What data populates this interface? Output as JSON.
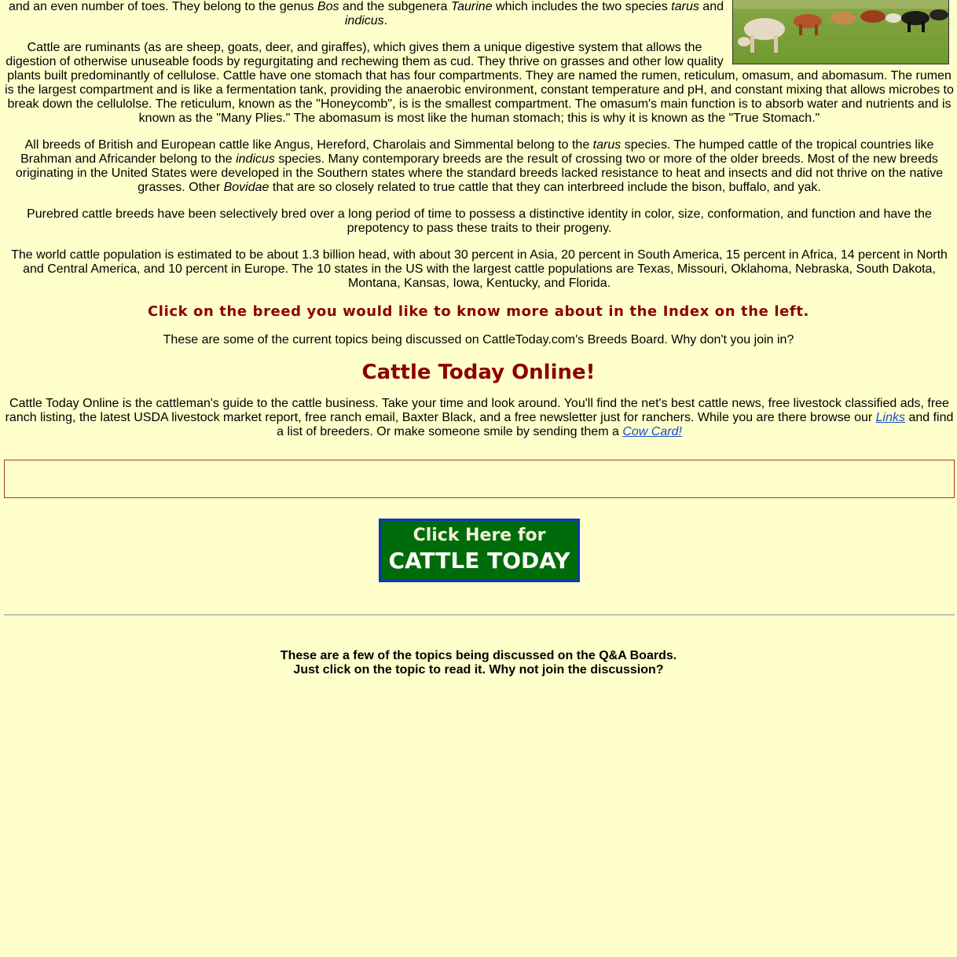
{
  "intro": {
    "p1_a": "and an even number of toes.  They belong to the genus ",
    "p1_genus": "Bos",
    "p1_b": " and the subgenera ",
    "p1_subgenera": "Taurine",
    "p1_c": " which includes the two species ",
    "p1_species1": "tarus",
    "p1_d": " and ",
    "p1_species2": "indicus",
    "p1_e": "."
  },
  "photo": {
    "subject": "cattle grazing in a green pasture"
  },
  "ruminant": {
    "lead": "Cattle are ruminants (as are sheep, goats, deer, and giraffes), which gives them a unique digestive system that allows the digestion of otherwise unuseable foods by regurgitating and rechewing them as cud. They thrive on grasses and other low quality",
    "rest": " plants built predominantly of cellulose. Cattle have one stomach that has four compartments. They are named the rumen, reticulum, omasum, and abomasum. The rumen is the largest compartment and is like a fermentation tank, providing the anaerobic environment, constant temperature and pH, and constant mixing that allows microbes to break down the cellulolse. The reticulum, known as the \"Honeycomb\", is is the smallest compartment. The omasum's main function is to absorb water and nutrients and is known as the \"Many Plies.\" The abomasum is most like the human stomach; this is why it is known as the \"True Stomach.\""
  },
  "breeds": {
    "a": "All breeds of British and European cattle like Angus, Hereford, Charolais and Simmental belong to the ",
    "tarus": "tarus",
    "b": " species.  The humped cattle of the tropical countries like Brahman and Africander belong to the ",
    "indicus": "indicus",
    "c": " species.  Many contemporary breeds are the result of crossing two or more of the older breeds.  Most of the new breeds originating in the United States were developed in the Southern states where the standard breeds lacked resistance to heat and insects and did not thrive on the native grasses.  Other ",
    "bovidae": "Bovidae",
    "d": " that are so closely related to true cattle that they can interbreed include the bison, buffalo, and yak."
  },
  "purebred": "Purebred cattle breeds have been selectively bred over a long period of time to possess a distinctive identity in color, size, conformation, and function and have the prepotency to pass these traits to their progeny.",
  "population": "The world cattle population is estimated to be about 1.3 billion head, with about 30 percent in Asia, 20 percent in South America, 15 percent in Africa, 14 percent in North and Central America, and 10 percent in Europe.  The 10 states in the US with the  largest cattle populations  are Texas, Missouri, Oklahoma, Nebraska, South Dakota, Montana, Kansas, Iowa, Kentucky, and Florida.",
  "cta": "Click on the breed you would like to know more about in the Index on the left.",
  "board_intro": "These are some of the current topics being discussed on CattleToday.com's Breeds Board. Why don't you join in?",
  "online": {
    "heading": "Cattle Today Online!",
    "text_a": "Cattle Today Online is the cattleman's guide to the cattle business. Take your time and look around. You'll find the net's best cattle news, free livestock classified ads, free ranch listing, the latest USDA livestock market report, free ranch email, Baxter Black, and a free newsletter just for ranchers. While you are there browse our ",
    "links_label": "Links",
    "text_b": " and find a list of breeders.  Or make someone smile by sending them a ",
    "cowcard_label": "Cow Card!"
  },
  "banner": {
    "line1": "Click Here for",
    "line2": "CATTLE TODAY"
  },
  "qa": {
    "line1": "These are a few of the topics being discussed on the Q&A Boards.",
    "line2": "Just click on the topic to read it.   Why not join the discussion?"
  },
  "colors": {
    "background": "#ffffcc",
    "accent_red": "#8b0000",
    "banner_green": "#006b0a",
    "link_blue": "#1a4bc8"
  }
}
